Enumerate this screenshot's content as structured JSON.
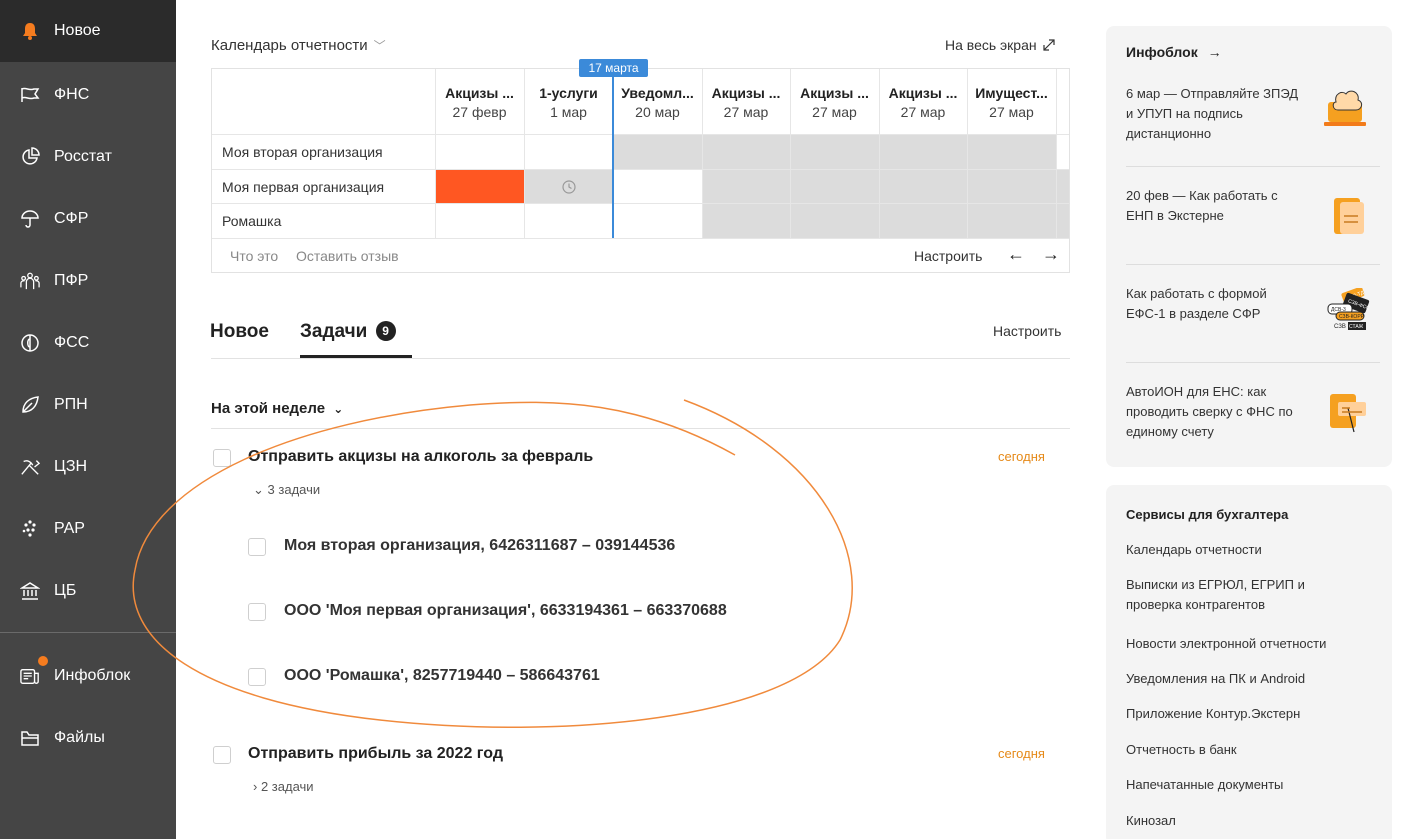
{
  "sidebar": {
    "items": [
      {
        "label": "Новое",
        "icon": "bell-icon"
      },
      {
        "label": "ФНС",
        "icon": "flag-icon"
      },
      {
        "label": "Росстат",
        "icon": "pie-chart-icon"
      },
      {
        "label": "СФР",
        "icon": "umbrella-icon"
      },
      {
        "label": "ПФР",
        "icon": "people-icon"
      },
      {
        "label": "ФСС",
        "icon": "shield-icon"
      },
      {
        "label": "РПН",
        "icon": "leaf-icon"
      },
      {
        "label": "ЦЗН",
        "icon": "tools-icon"
      },
      {
        "label": "РАР",
        "icon": "grapes-icon"
      },
      {
        "label": "ЦБ",
        "icon": "bank-icon"
      },
      {
        "label": "Инфоблок",
        "icon": "news-icon"
      },
      {
        "label": "Файлы",
        "icon": "folder-icon"
      }
    ]
  },
  "calendar": {
    "title": "Календарь отчетности",
    "fullscreen_label": "На весь экран",
    "today_label": "17 марта",
    "columns": [
      {
        "name": "Акцизы ...",
        "date": "27 февр"
      },
      {
        "name": "1-услуги",
        "date": "1 мар"
      },
      {
        "name": "Уведомл...",
        "date": "20 мар"
      },
      {
        "name": "Акцизы ...",
        "date": "27 мар"
      },
      {
        "name": "Акцизы ...",
        "date": "27 мар"
      },
      {
        "name": "Акцизы ...",
        "date": "27 мар"
      },
      {
        "name": "Имущест...",
        "date": "27 мар"
      }
    ],
    "orgs": [
      "Моя вторая организация",
      "Моя первая организация",
      "Ромашка"
    ],
    "footer": {
      "what": "Что это",
      "feedback": "Оставить отзыв",
      "configure": "Настроить"
    }
  },
  "tabs": {
    "new_label": "Новое",
    "tasks_label": "Задачи",
    "tasks_count": "9",
    "configure": "Настроить"
  },
  "week_label": "На этой неделе",
  "tasks": [
    {
      "title": "Отправить акцизы на алкоголь за февраль",
      "due": "сегодня",
      "toggle": "3 задачи",
      "subtasks": [
        "Моя вторая организация, 6426311687 – 039144536",
        "ООО 'Моя первая организация', 6633194361 – 663370688",
        "ООО 'Ромашка', 8257719440 – 586643761"
      ]
    },
    {
      "title": "Отправить прибыль за 2022 год",
      "due": "сегодня",
      "toggle": "2 задачи"
    }
  ],
  "infoblock": {
    "title": "Инфоблок",
    "news": [
      "6 мар — Отправляйте ЗПЭД и УПУП на подпись дистанционно",
      "20 фев — Как работать с ЕНП в Экстерне",
      "Как работать с формой ЕФС-1 в разделе СФР",
      "АвтоИОН для ЕНС: как проводить сверку с ФНС по единому счету"
    ],
    "thumb_text": [
      "СЗВ-ТД",
      "СЗВ-ФСС",
      "ДСВ-3",
      "СЗВ-КОРР",
      "СЗВ",
      "СТАЖ"
    ]
  },
  "services": {
    "title": "Сервисы для бухгалтера",
    "links": [
      "Календарь отчетности",
      "Выписки из ЕГРЮЛ, ЕГРИП и проверка контрагентов",
      "Новости электронной отчетности",
      "Уведомления на ПК и Android",
      "Приложение Контур.Экстерн",
      "Отчетность в банк",
      "Напечатанные документы",
      "Кинозал"
    ]
  },
  "colors": {
    "sidebar_bg": "#454545",
    "sidebar_active": "#2b2b2b",
    "accent_orange": "#f57c1f",
    "filled_cell": "#ff5722",
    "today_blue": "#3b8ad9",
    "due_text": "#e68a19"
  }
}
